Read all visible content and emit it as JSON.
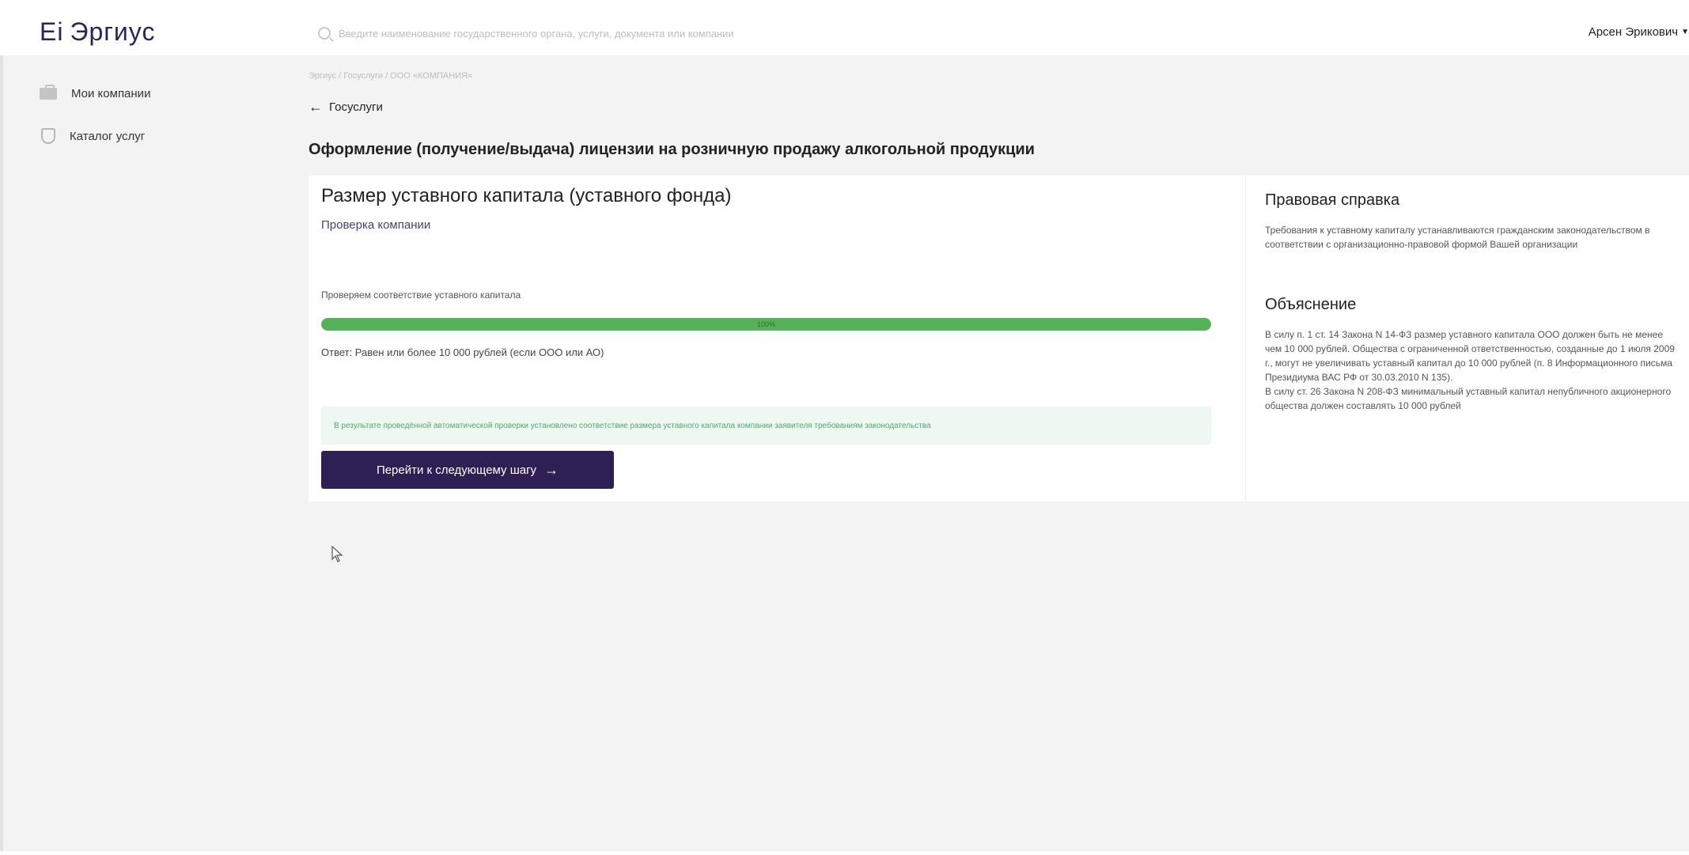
{
  "header": {
    "logo_mark": "Ei",
    "logo_text": "Эргиус",
    "search_placeholder": "Введите наименование государственного органа, услуги, документа или компании",
    "user_name": "Арсен Эрикович"
  },
  "sidebar": {
    "items": [
      {
        "label": "Мои компании",
        "icon": "briefcase-icon"
      },
      {
        "label": "Каталог услуг",
        "icon": "shield-icon"
      }
    ]
  },
  "main": {
    "breadcrumb": "Эргиус / Госуслуги / ООО «КОМПАНИЯ»",
    "back_label": "Госуслуги",
    "page_title": "Оформление (получение/выдача) лицензии на розничную продажу алкогольной продукции",
    "step": {
      "title": "Размер уставного капитала (уставного фонда)",
      "subtitle": "Проверка компании",
      "check_label": "Проверяем соответствие уставного капитала",
      "progress_percent": 100,
      "progress_text": "100%",
      "answer": "Ответ: Равен или более 10 000 рублей (если ООО или АО)",
      "result": "В результате проведённой автоматической проверки установлено соответствие размера уставного капитала компании заявителя требованиям законодательства",
      "next_button_label": "Перейти к следующему шагу"
    }
  },
  "side_panel": {
    "legal_title": "Правовая справка",
    "legal_text": "Требования к уставному капиталу устанавливаются гражданским законодательством в соответствии с организационно-правовой формой Вашей организации",
    "explanation_title": "Объяснение",
    "explanation_text_1": "В силу п. 1 ст. 14 Закона N 14-ФЗ размер уставного капитала ООО должен быть не менее чем 10 000 рублей. Общества с ограниченной ответственностью, созданные до 1 июля 2009 г., могут не увеличивать уставный капитал до 10 000 рублей (п. 8 Информационного письма Президиума ВАС РФ от 30.03.2010 N 135).",
    "explanation_text_2": "В силу ст. 26 Закона N 208-ФЗ минимальный уставный капитал непубличного акционерного общества должен составлять 10 000 рублей"
  },
  "colors": {
    "brand": "#2e1f55",
    "progress": "#57b15a",
    "result_bg": "#eef7f1",
    "result_text": "#5aa56a"
  }
}
